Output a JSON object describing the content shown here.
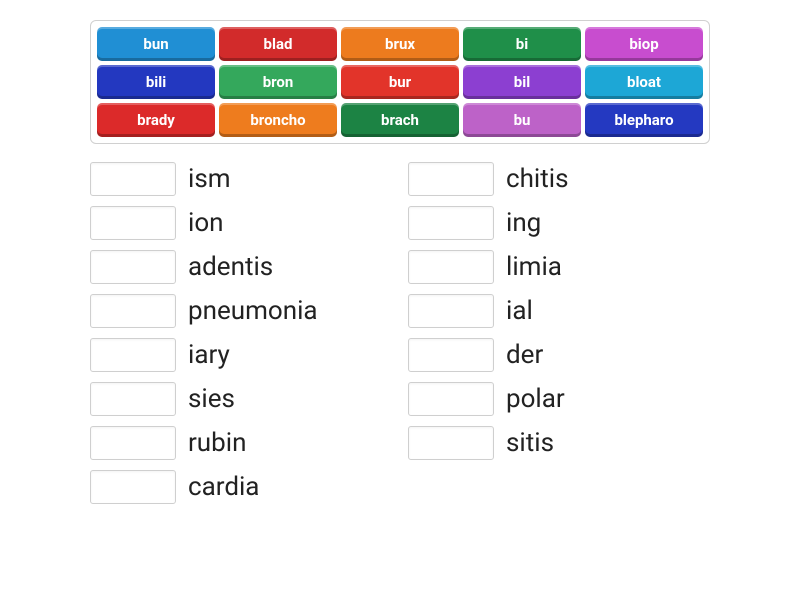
{
  "tiles": [
    {
      "label": "bun",
      "color": "c-blue1"
    },
    {
      "label": "blad",
      "color": "c-red"
    },
    {
      "label": "brux",
      "color": "c-orange"
    },
    {
      "label": "bi",
      "color": "c-green"
    },
    {
      "label": "biop",
      "color": "c-pink"
    },
    {
      "label": "bili",
      "color": "c-blue2"
    },
    {
      "label": "bron",
      "color": "c-green2"
    },
    {
      "label": "bur",
      "color": "c-red2"
    },
    {
      "label": "bil",
      "color": "c-purple"
    },
    {
      "label": "bloat",
      "color": "c-teal"
    },
    {
      "label": "brady",
      "color": "c-red3"
    },
    {
      "label": "broncho",
      "color": "c-orange2"
    },
    {
      "label": "brach",
      "color": "c-green3"
    },
    {
      "label": "bu",
      "color": "c-mauve"
    },
    {
      "label": "blepharo",
      "color": "c-blue3"
    }
  ],
  "left_column": [
    {
      "suffix": "ism"
    },
    {
      "suffix": "ion"
    },
    {
      "suffix": "adentis"
    },
    {
      "suffix": "pneumonia"
    },
    {
      "suffix": "iary"
    },
    {
      "suffix": "sies"
    },
    {
      "suffix": "rubin"
    },
    {
      "suffix": "cardia"
    }
  ],
  "right_column": [
    {
      "suffix": "chitis"
    },
    {
      "suffix": "ing"
    },
    {
      "suffix": "limia"
    },
    {
      "suffix": "ial"
    },
    {
      "suffix": "der"
    },
    {
      "suffix": "polar"
    },
    {
      "suffix": "sitis"
    }
  ]
}
